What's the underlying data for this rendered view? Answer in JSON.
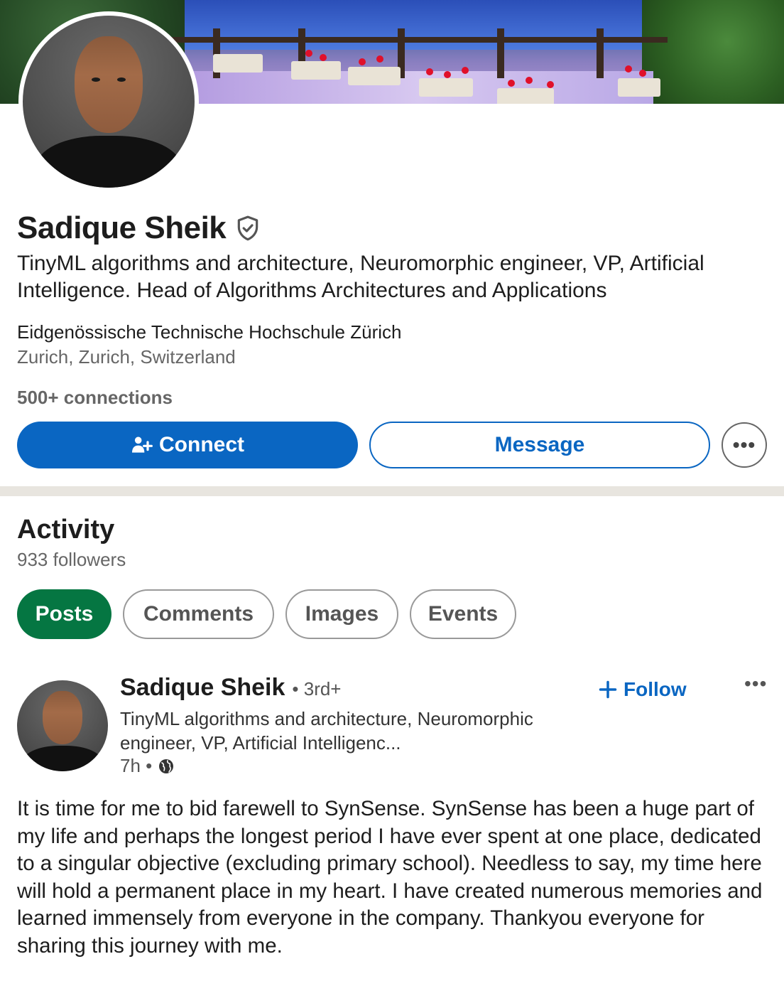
{
  "profile": {
    "name": "Sadique Sheik",
    "headline": "TinyML algorithms and architecture, Neuromorphic engineer, VP, Artificial Intelligence. Head of Algorithms Architectures and Applications",
    "school": "Eidgenössische Technische Hochschule Zürich",
    "location": "Zurich, Zurich, Switzerland",
    "connections": "500+ connections"
  },
  "actions": {
    "connect_label": "Connect",
    "message_label": "Message",
    "more_label": "•••"
  },
  "activity": {
    "title": "Activity",
    "followers": "933 followers",
    "tabs": [
      {
        "label": "Posts",
        "active": true
      },
      {
        "label": "Comments",
        "active": false
      },
      {
        "label": "Images",
        "active": false
      },
      {
        "label": "Events",
        "active": false
      }
    ]
  },
  "post": {
    "author": "Sadique Sheik",
    "degree": "• 3rd+",
    "headline": "TinyML algorithms and architecture, Neuromorphic engineer, VP, Artificial Intelligenc...",
    "time": "7h •",
    "follow_label": "Follow",
    "more_label": "•••",
    "body": "It is time for me to bid farewell to SynSense. SynSense has been a huge part of my life and perhaps the longest period I have ever spent at one place, dedicated to a singular objective (excluding primary school). Needless to say, my time here will hold a permanent place in my heart. I have created numerous memories and learned immensely from everyone in the company. Thankyou everyone for sharing this journey with me."
  },
  "colors": {
    "primary": "#0a66c2",
    "active_pill": "#057642",
    "divider": "#e8e5df"
  }
}
